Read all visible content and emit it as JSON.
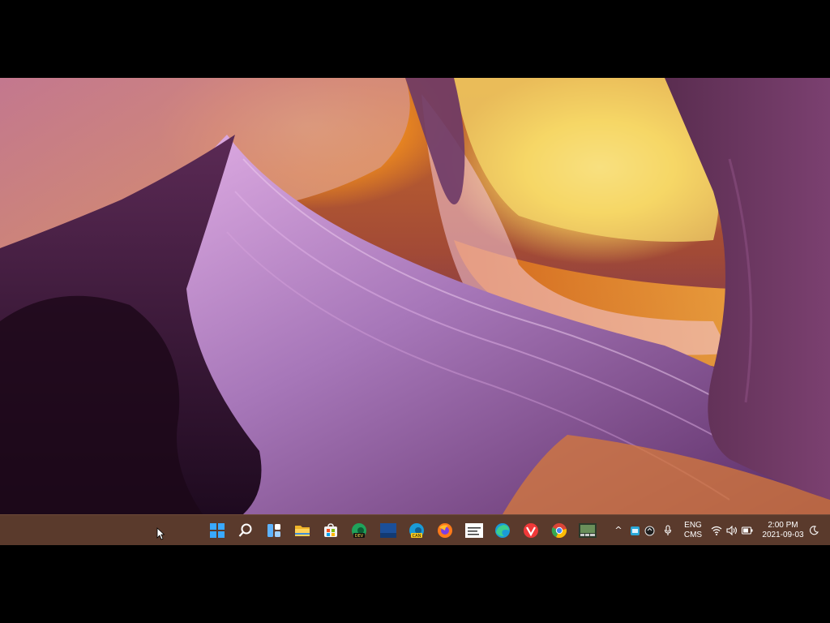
{
  "desktop": {
    "wallpaper": "Antelope Canyon sandstone wallpaper"
  },
  "taskbar": {
    "background_color": "#5a3a2c",
    "pinned_apps": [
      {
        "name": "start-icon",
        "color": "#2fa4ff"
      },
      {
        "name": "search-icon",
        "color": "#ffffff"
      },
      {
        "name": "widgets-icon",
        "color": "#5eb3ff"
      },
      {
        "name": "file-explorer-icon",
        "color": "#f5c242"
      },
      {
        "name": "microsoft-store-icon",
        "color": "#ffffff"
      },
      {
        "name": "edge-dev-icon",
        "color": "#1fa35b",
        "badge": "DEV"
      },
      {
        "name": "app-blue-square-icon",
        "color": "#1b4f9a"
      },
      {
        "name": "edge-canary-icon",
        "color": "#1a9bd7",
        "badge": "CAN"
      },
      {
        "name": "firefox-icon",
        "color": "#ff7a1a"
      },
      {
        "name": "document-app-icon",
        "color": "#ffffff"
      },
      {
        "name": "edge-icon",
        "color": "#1a9bd7"
      },
      {
        "name": "vivaldi-icon",
        "color": "#ef3939"
      },
      {
        "name": "chrome-icon",
        "color": "#34a853"
      },
      {
        "name": "media-app-icon",
        "color": "#6a8f5a"
      }
    ],
    "tray": {
      "chevron": "^",
      "language_top": "ENG",
      "language_bottom": "CMS",
      "time": "2:00 PM",
      "date": "2021-09-03"
    }
  }
}
